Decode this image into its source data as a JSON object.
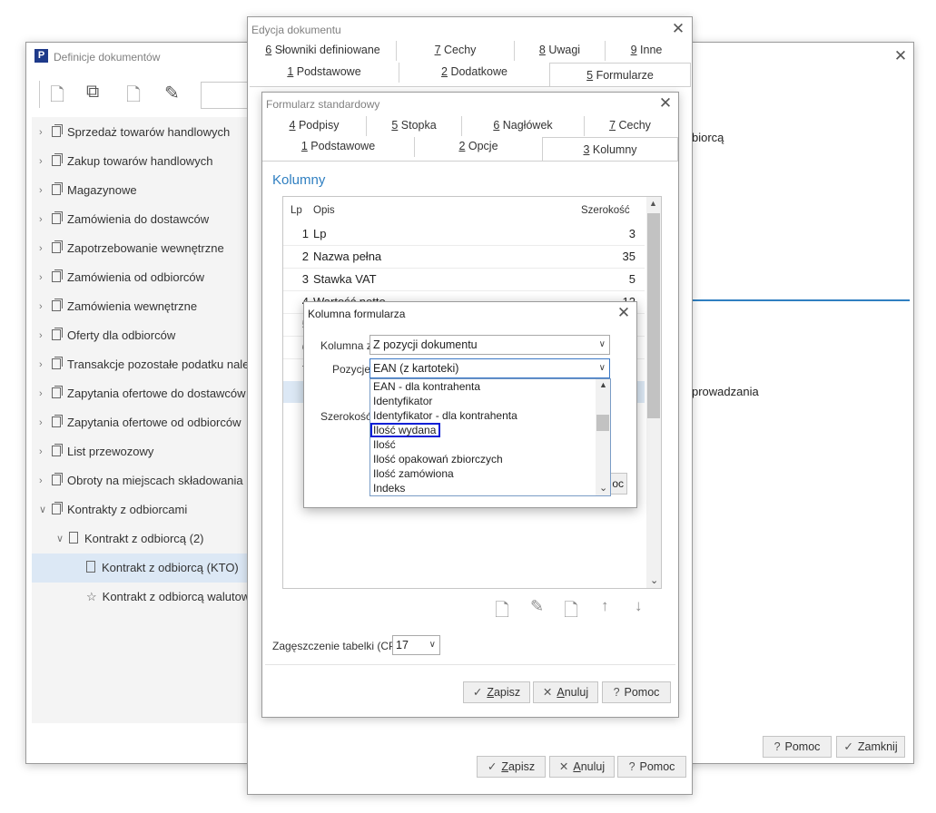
{
  "bg_window": {
    "title": "Definicje dokumentów",
    "tree": [
      {
        "label": "Sprzedaż towarów handlowych",
        "level": 0,
        "icon": "folder"
      },
      {
        "label": "Zakup towarów handlowych",
        "level": 0,
        "icon": "folder"
      },
      {
        "label": "Magazynowe",
        "level": 0,
        "icon": "folder"
      },
      {
        "label": "Zamówienia do dostawców",
        "level": 0,
        "icon": "folder"
      },
      {
        "label": "Zapotrzebowanie wewnętrzne",
        "level": 0,
        "icon": "folder"
      },
      {
        "label": "Zamówienia od odbiorców",
        "level": 0,
        "icon": "folder"
      },
      {
        "label": "Zamówienia wewnętrzne",
        "level": 0,
        "icon": "folder"
      },
      {
        "label": "Oferty dla odbiorców",
        "level": 0,
        "icon": "folder"
      },
      {
        "label": "Transakcje pozostałe podatku nale",
        "level": 0,
        "icon": "folder"
      },
      {
        "label": "Zapytania ofertowe do dostawców",
        "level": 0,
        "icon": "folder"
      },
      {
        "label": "Zapytania ofertowe od odbiorców",
        "level": 0,
        "icon": "folder"
      },
      {
        "label": "List przewozowy",
        "level": 0,
        "icon": "folder"
      },
      {
        "label": "Obroty na miejscach składowania",
        "level": 0,
        "icon": "folder"
      },
      {
        "label": "Kontrakty z odbiorcami",
        "level": 0,
        "icon": "folder"
      },
      {
        "label": "Kontrakt z odbiorcą (2)",
        "level": 1,
        "icon": "doc"
      },
      {
        "label": "Kontrakt z odbiorcą (KTO)",
        "level": 2,
        "icon": "doc"
      },
      {
        "label": "Kontrakt z odbiorcą walutow",
        "level": 2,
        "icon": "star"
      }
    ],
    "right_text_1": "biorcą",
    "right_text_2": "prowadzania",
    "help_label": "Pomoc",
    "close_label": "Zamknij",
    "logo_letter": "P",
    "logo_color": "#1e3a8a"
  },
  "edit_window": {
    "title": "Edycja dokumentu",
    "tabs_row1": [
      {
        "key": "6",
        "rest": " Słowniki definiowane"
      },
      {
        "key": "7",
        "rest": " Cechy"
      },
      {
        "key": "8",
        "rest": " Uwagi"
      },
      {
        "key": "9",
        "rest": " Inne"
      }
    ],
    "tabs_row2": [
      {
        "key": "1",
        "rest": " Podstawowe"
      },
      {
        "key": "2",
        "rest": " Dodatkowe"
      },
      {
        "key": "5",
        "rest": " Formularze"
      }
    ],
    "save_label": "Zapisz",
    "save_key": "Z",
    "cancel_label": "Anuluj",
    "cancel_key": "A",
    "help_label": "Pomoc"
  },
  "form_window": {
    "title": "Formularz standardowy",
    "tabs_row1": [
      {
        "key": "4",
        "rest": " Podpisy"
      },
      {
        "key": "5",
        "rest": " Stopka"
      },
      {
        "key": "6",
        "rest": " Nagłówek"
      },
      {
        "key": "7",
        "rest": " Cechy"
      }
    ],
    "tabs_row2": [
      {
        "key": "1",
        "rest": " Podstawowe"
      },
      {
        "key": "2",
        "rest": " Opcje"
      },
      {
        "key": "3",
        "rest": " Kolumny"
      }
    ],
    "section_title": "Kolumny",
    "section_color": "#2f7fc1",
    "headers": {
      "lp": "Lp",
      "opis": "Opis",
      "szer": "Szerokość"
    },
    "rows": [
      {
        "lp": "1",
        "opis": "Lp",
        "szer": "3"
      },
      {
        "lp": "2",
        "opis": "Nazwa pełna",
        "szer": "35"
      },
      {
        "lp": "3",
        "opis": "Stawka VAT",
        "szer": "5"
      },
      {
        "lp": "4",
        "opis": "Wartość netto",
        "szer": "12"
      },
      {
        "lp": "5",
        "opis": "",
        "szer": ""
      },
      {
        "lp": "6",
        "opis": "",
        "szer": ""
      },
      {
        "lp": "7",
        "opis": "",
        "szer": ""
      }
    ],
    "cpi_label": "Zagęszczenie tabelki (CPI)",
    "cpi_value": "17",
    "save_label": "Zapisz",
    "save_key": "Z",
    "cancel_label": "Anuluj",
    "cancel_key": "A",
    "help_label": "Pomoc"
  },
  "column_dialog": {
    "title": "Kolumna formularza",
    "kolumna_label": "Kolumna z",
    "kolumna_value": "Z pozycji dokumentu",
    "pozycje_label": "Pozycje",
    "pozycje_value": "EAN (z kartoteki)",
    "szerokosc_label": "Szerokość",
    "options": [
      "EAN - dla kontrahenta",
      "Identyfikator",
      "Identyfikator - dla kontrahenta",
      "Ilość wydana",
      "Ilość",
      "Ilość opakowań zbiorczych",
      "Ilość zamówiona",
      "Indeks"
    ],
    "highlighted_index": 3,
    "highlight_color": "#0a1fd6",
    "hidden_button_text": "oc"
  }
}
